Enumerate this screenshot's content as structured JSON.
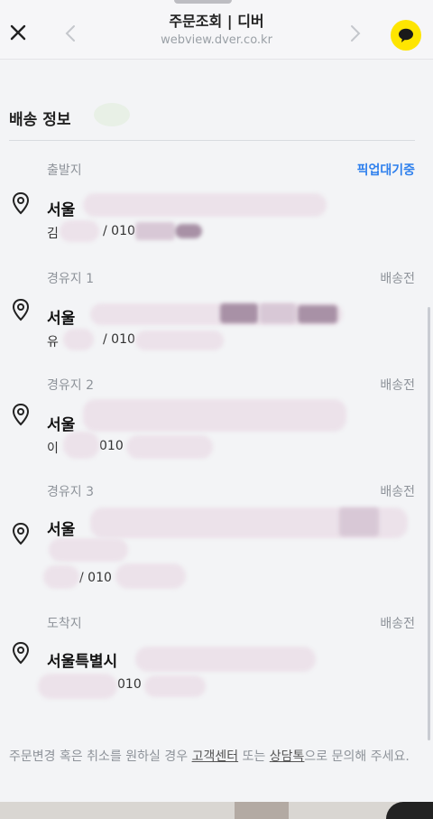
{
  "browser": {
    "title": "주문조회 | 디버",
    "url": "webview.dver.co.kr",
    "close_icon": "close-icon",
    "back_icon": "chevron-left-icon",
    "forward_icon": "chevron-right-icon",
    "share_icon": "kakao-talk-icon"
  },
  "section": {
    "title": "배송 정보"
  },
  "stops": [
    {
      "label": "출발지",
      "status": "픽업대기중",
      "city": "서울",
      "contact_prefix": "김",
      "contact_phone": "/ 010"
    },
    {
      "label": "경유지 1",
      "status": "배송전",
      "city": "서울",
      "contact_prefix": "유",
      "contact_phone": "/ 010"
    },
    {
      "label": "경유지 2",
      "status": "배송전",
      "city": "서울",
      "contact_prefix": "이",
      "contact_phone": "010"
    },
    {
      "label": "경유지 3",
      "status": "배송전",
      "city": "서울",
      "contact_prefix": "",
      "contact_phone": "/ 010"
    },
    {
      "label": "도착지",
      "status": "배송전",
      "city": "서울특별시",
      "contact_prefix": "",
      "contact_phone": "010"
    }
  ],
  "notice": {
    "text_before": "주문변경 혹은 취소를 원하실 경우 ",
    "link_customer_center": "고객센터",
    "text_middle": " 또는 ",
    "link_chat": "상담톡",
    "text_after": "으로 문의해 주세요."
  },
  "colors": {
    "accent_blue": "#2f80ed",
    "kakao_yellow": "#fee500",
    "muted_text": "#8e939a"
  }
}
